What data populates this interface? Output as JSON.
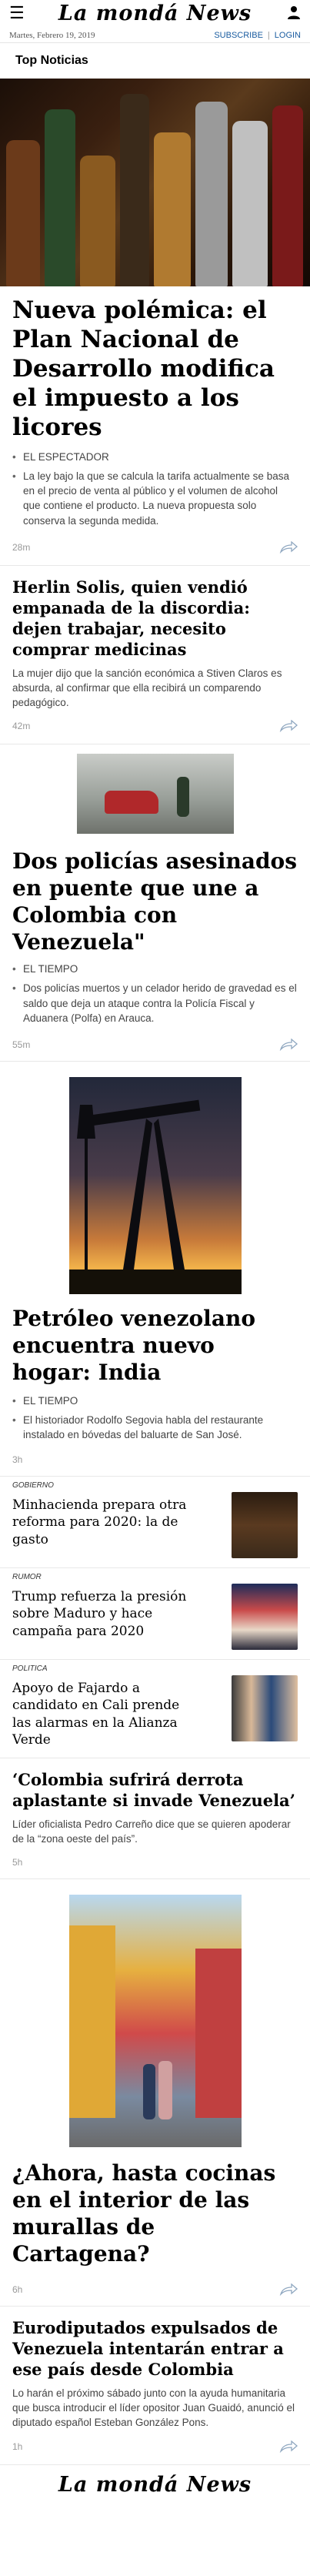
{
  "header": {
    "masthead": "La mondá News",
    "date": "Martes, Febrero 19, 2019",
    "subscribe": "SUBSCRIBE",
    "separator": "|",
    "login": "LOGIN",
    "menu_glyph": "☰"
  },
  "section": {
    "title": "Top Noticias"
  },
  "articles": [
    {
      "title": "Nueva polémica: el Plan Nacional de Desarrollo modifica el impuesto a los licores",
      "source": "EL ESPECTADOR",
      "bullet": "La ley bajo la que se calcula la tarifa actualmente se basa en el precio de venta al público y el volumen de alcohol que contiene el producto. La nueva propuesta solo conserva la segunda medida.",
      "time": "28m"
    },
    {
      "title": "Herlin Solis, quien vendió empanada de la discordia: dejen trabajar, necesito comprar medicinas",
      "summary": "La mujer dijo que la sanción económica a Stiven Claros es absurda, al confirmar que ella recibirá un comparendo pedagógico.",
      "time": "42m"
    },
    {
      "title": "Dos policías asesinados en puente que une a Colombia con Venezuela\"",
      "source": "EL TIEMPO",
      "bullet": "Dos policías muertos y un celador herido de gravedad es el saldo que deja un ataque contra la Policía Fiscal y Aduanera (Polfa) en Arauca.",
      "time": "55m"
    },
    {
      "title": "Petróleo venezolano encuentra nuevo hogar: India",
      "source": "EL TIEMPO",
      "bullet": "El historiador Rodolfo Segovia habla del restaurante instalado en bóvedas del baluarte de San José.",
      "time": "3h"
    },
    {
      "kicker": "GOBIERNO",
      "title": "Minhacienda prepara otra reforma para 2020: la de gasto"
    },
    {
      "kicker": "RUMOR",
      "title": "Trump refuerza la presión sobre Maduro y hace campaña para 2020"
    },
    {
      "kicker": "POLITICA",
      "title": "Apoyo de Fajardo a candidato en Cali prende las alarmas en la Alianza Verde"
    },
    {
      "title": "‘Colombia sufrirá derrota aplastante si invade Venezuela’",
      "summary": "Líder oficialista Pedro Carreño dice que se quieren apoderar de la “zona oeste del país”.",
      "time": "5h"
    },
    {
      "title": "¿Ahora, hasta cocinas en el interior de las murallas de Cartagena?",
      "time": "6h"
    },
    {
      "title": "Eurodiputados expulsados de Venezuela intentarán entrar a ese país desde Colombia",
      "summary": "Lo harán el próximo sábado junto con la ayuda humanitaria que busca introducir el líder opositor Juan Guaidó, anunció el diputado español Esteban González Pons.",
      "time": "1h"
    }
  ],
  "footer": {
    "masthead": "La mondá News"
  },
  "colors": {
    "link": "#1a5ca0",
    "divider": "#e8e8e8",
    "meta": "#999999"
  }
}
